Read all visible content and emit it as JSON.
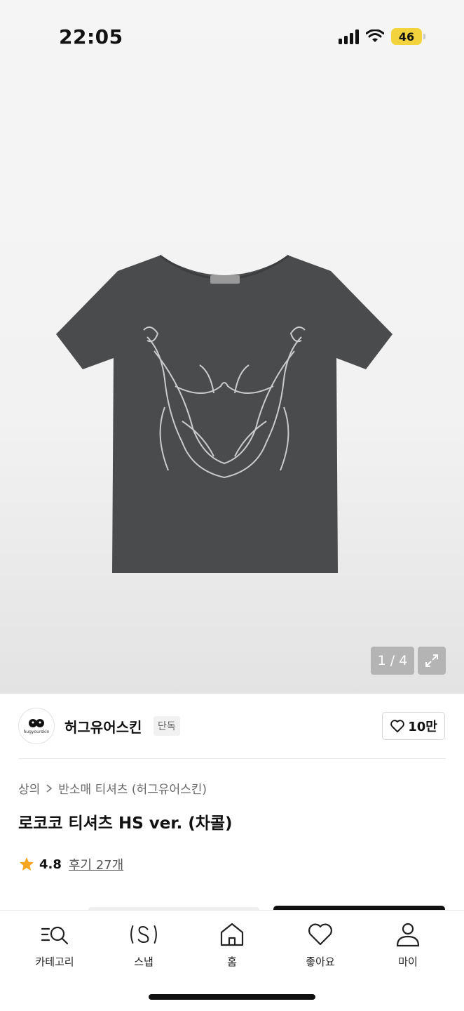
{
  "status_bar": {
    "time": "22:05",
    "battery": "46"
  },
  "gallery": {
    "counter": "1 / 4",
    "image": "tshirt-product-image"
  },
  "brand": {
    "name": "허그유어스킨",
    "tag": "단독",
    "logo_text": "hugyourskin",
    "likes": "10만"
  },
  "breadcrumb": {
    "category": "상의",
    "subcategory": "반소매 티셔츠 (허그유어스킨)"
  },
  "product": {
    "title": "로코코 티셔츠 HS ver. (차콜)",
    "rating": "4.8",
    "reviews": "후기 27개"
  },
  "nav": {
    "items": [
      {
        "label": "카테고리",
        "icon": "category-search-icon"
      },
      {
        "label": "스냅",
        "icon": "snap-icon"
      },
      {
        "label": "홈",
        "icon": "home-icon"
      },
      {
        "label": "좋아요",
        "icon": "heart-icon"
      },
      {
        "label": "마이",
        "icon": "profile-icon"
      }
    ]
  },
  "colors": {
    "accent_star": "#f5a623",
    "shirt": "#4a4b4d",
    "battery": "#f2d33d"
  }
}
